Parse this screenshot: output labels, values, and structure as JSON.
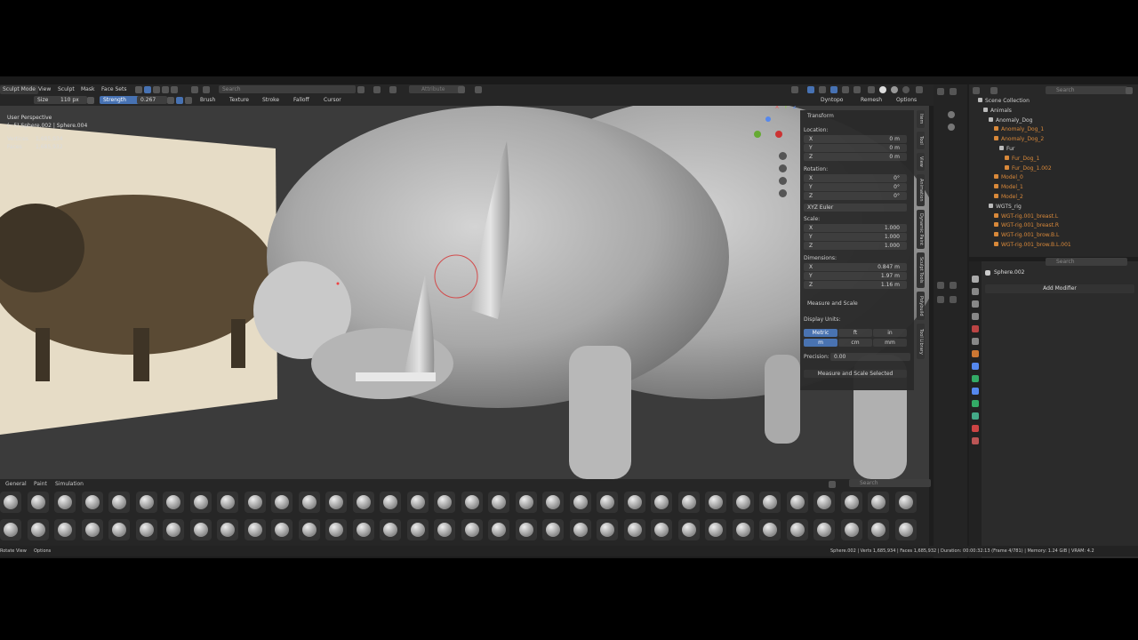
{
  "topbar": {
    "mode": "Sculpt Mode",
    "menus": [
      "View",
      "Sculpt",
      "Mask",
      "Face Sets"
    ],
    "search_placeholder": "Search",
    "attribute": "Attribute"
  },
  "toolheader": {
    "size_label": "Size",
    "size_value": "110 px",
    "strength_label": "Strength",
    "strength_value": "0.267",
    "menus": [
      "Brush",
      "Texture",
      "Stroke",
      "Falloff",
      "Cursor"
    ],
    "dyntopo": "Dyntopo",
    "remesh": "Remesh",
    "options": "Options"
  },
  "viewport": {
    "view_name": "User Perspective",
    "object_info": "(~5) Sphere.002 | Sphere.004",
    "stats": [
      {
        "label": "Vertices",
        "value": "1,685,934"
      },
      {
        "label": "Faces",
        "value": "1,685,932"
      }
    ],
    "gizmo_axes": [
      "X",
      "Y",
      "Z"
    ]
  },
  "npanel": {
    "transform_title": "Transform",
    "location_label": "Location:",
    "location": [
      {
        "axis": "X",
        "value": "0 m"
      },
      {
        "axis": "Y",
        "value": "0 m"
      },
      {
        "axis": "Z",
        "value": "0 m"
      }
    ],
    "rotation_label": "Rotation:",
    "rotation": [
      {
        "axis": "X",
        "value": "0°"
      },
      {
        "axis": "Y",
        "value": "0°"
      },
      {
        "axis": "Z",
        "value": "0°"
      }
    ],
    "rotation_mode": "XYZ Euler",
    "scale_label": "Scale:",
    "scale": [
      {
        "axis": "X",
        "value": "1.000"
      },
      {
        "axis": "Y",
        "value": "1.000"
      },
      {
        "axis": "Z",
        "value": "1.000"
      }
    ],
    "dimensions_label": "Dimensions:",
    "dimensions": [
      {
        "axis": "X",
        "value": "0.847 m"
      },
      {
        "axis": "Y",
        "value": "1.97 m"
      },
      {
        "axis": "Z",
        "value": "1.16 m"
      }
    ],
    "measure_title": "Measure and Scale",
    "display_units_label": "Display Units:",
    "units_row1": [
      "Metric",
      "ft",
      "in"
    ],
    "units_row2": [
      "m",
      "cm",
      "mm"
    ],
    "precision_label": "Precision:",
    "precision_value": "0.00",
    "measure_selected": "Measure and Scale Selected",
    "tabs": [
      "Item",
      "Tool",
      "View",
      "Animation",
      "Dynamic Paint",
      "Sculpt Tools",
      "Polybuild",
      "Tool Library"
    ]
  },
  "outliner": {
    "search_placeholder": "Search",
    "rows": [
      {
        "label": "Scene Collection",
        "depth": 0,
        "type": "collection"
      },
      {
        "label": "Animals",
        "depth": 1,
        "type": "collection"
      },
      {
        "label": "Anomaly_Dog",
        "depth": 2,
        "type": "collection"
      },
      {
        "label": "Anomaly_Dog_1",
        "depth": 3,
        "type": "object"
      },
      {
        "label": "Anomaly_Dog_2",
        "depth": 3,
        "type": "object"
      },
      {
        "label": "Fur",
        "depth": 4,
        "type": "collection"
      },
      {
        "label": "Fur_Dog_1",
        "depth": 5,
        "type": "object"
      },
      {
        "label": "Fur_Dog_1.002",
        "depth": 5,
        "type": "object"
      },
      {
        "label": "Model_0",
        "depth": 3,
        "type": "object"
      },
      {
        "label": "Model_1",
        "depth": 3,
        "type": "object"
      },
      {
        "label": "Model_2",
        "depth": 3,
        "type": "object"
      },
      {
        "label": "WGTS_rig",
        "depth": 2,
        "type": "collection"
      },
      {
        "label": "WGT-rig.001_breast.L",
        "depth": 3,
        "type": "object"
      },
      {
        "label": "WGT-rig.001_breast.R",
        "depth": 3,
        "type": "object"
      },
      {
        "label": "WGT-rig.001_brow.B.L",
        "depth": 3,
        "type": "object"
      },
      {
        "label": "WGT-rig.001_brow.B.L.001",
        "depth": 3,
        "type": "object"
      }
    ]
  },
  "properties": {
    "search_placeholder": "Search",
    "object_name": "Sphere.002",
    "add_modifier": "Add Modifier"
  },
  "assetshelf": {
    "tabs": [
      "General",
      "Paint",
      "Simulation"
    ],
    "search_placeholder": "Search"
  },
  "statusbar": {
    "left": "Rotate View",
    "options": "Options",
    "right": "Sphere.002 | Verts 1,685,934 | Faces 1,685,932 | Duration: 00:00:32:13 (Frame 4/781) | Memory: 1.24 GiB | VRAM: 4.2"
  },
  "colors": {
    "accent_blue": "#4772b3",
    "panel": "#2a2a2a",
    "header": "#262626",
    "background": "#1d1d1d"
  }
}
